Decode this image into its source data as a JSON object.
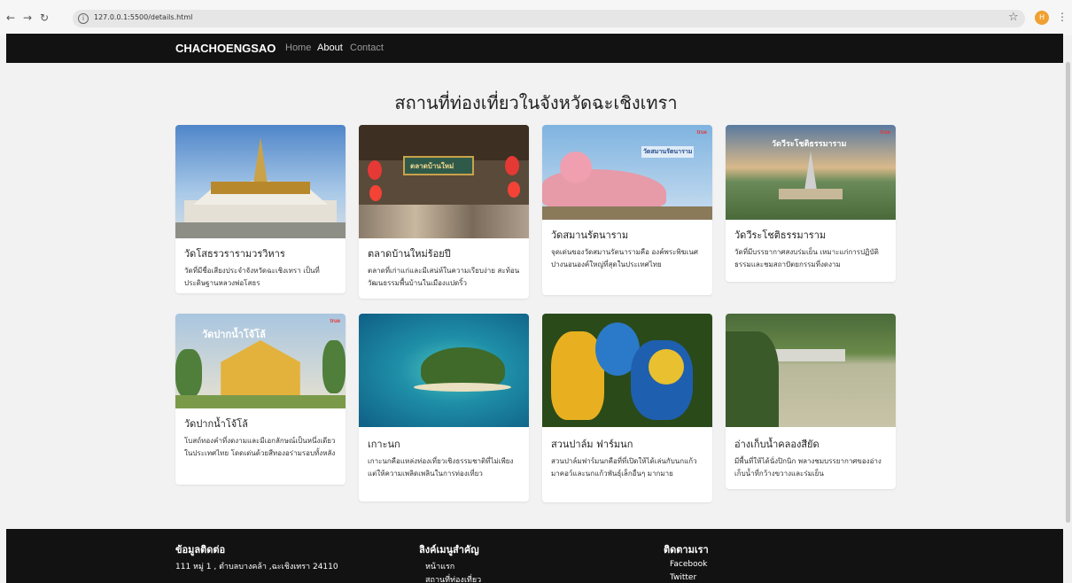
{
  "browser": {
    "url": "127.0.0.1:5500/details.html",
    "profile_initial": "H"
  },
  "navbar": {
    "brand": "CHACHOENGSAO",
    "links": [
      {
        "label": "Home",
        "active": false
      },
      {
        "label": "About",
        "active": true
      },
      {
        "label": "Contact",
        "active": false
      }
    ]
  },
  "main": {
    "title": "สถานที่ท่องเที่ยวในจังหวัดฉะเชิงเทรา",
    "cards": [
      {
        "title": "วัดโสธรวรารามวรวิหาร",
        "desc": "วัดที่มีชื่อเสียงประจำจังหวัดฉะเชิงเทรา เป็นที่ประดิษฐานหลวงพ่อโสธร"
      },
      {
        "title": "ตลาดบ้านใหม่ร้อยปี",
        "desc": "ตลาดที่เก่าแก่และมีเสน่ห์ในความเรียบง่าย สะท้อนวัฒนธรรมพื้นบ้านในเมืองแปดริ้ว",
        "sign": "ตลาดบ้านใหม่"
      },
      {
        "title": "วัดสมานรัตนาราม",
        "desc": "จุดเด่นของวัดสมานรัตนารามคือ องค์พระพิฆเนศปางนอนองค์ใหญ่ที่สุดในประเทศไทย",
        "badge": "true",
        "overlay": "วัดสมานรัตนาราม"
      },
      {
        "title": "วัดวีระโชติธรรมาราม",
        "desc": "วัดที่มีบรรยากาศสงบร่มเย็น เหมาะแก่การปฏิบัติธรรมและชมสถาปัตยกรรมที่งดงาม",
        "badge": "true",
        "overlay": "วัดวีระโชติธรรมาราม"
      },
      {
        "title": "วัดปากน้ำโจ้โล้",
        "desc": "โบสถ์ทองคำที่งดงามและมีเอกลักษณ์เป็นหนึ่งเดียวในประเทศไทย โดดเด่นด้วยสีทองอร่ามรอบทั้งหลัง",
        "badge": "true",
        "overlay": "วัดปากน้ำโจ้โล้"
      },
      {
        "title": "เกาะนก",
        "desc": "เกาะนกคือแหล่งท่องเที่ยวเชิงธรรมชาติที่ไม่เพียงแต่ให้ความเพลิดเพลินในการท่องเที่ยว"
      },
      {
        "title": "สวนปาล์ม ฟาร์มนก",
        "desc": "สวนปาล์มฟาร์มนกคือที่ที่เปิดให้ได้เล่นกับนกแก้วมาคอว์และนกแก้วพันธุ์เล็กอื่นๆ มากมาย"
      },
      {
        "title": "อ่างเก็บน้ำคลองสียัด",
        "desc": "มีพื้นที่ให้ได้นั่งปิกนิก พลางชมบรรยากาศของอ่างเก็บน้ำที่กว้างขวางและร่มเย็น"
      }
    ]
  },
  "footer": {
    "contact": {
      "title": "ข้อมูลติดต่อ",
      "address": "111 หมู่ 1 , ตำบลบางคล้า ,ฉะเชิงเทรา 24110"
    },
    "links": {
      "title": "ลิงค์เมนูสำคัญ",
      "items": [
        "หน้าแรก",
        "สถานที่ท่องเที่ยว"
      ]
    },
    "follow": {
      "title": "ติดตามเรา",
      "items": [
        "Facebook",
        "Twitter"
      ]
    }
  },
  "colors": {
    "navbar_bg": "#121212",
    "page_bg": "#f2f2f2",
    "card_bg": "#ffffff"
  }
}
